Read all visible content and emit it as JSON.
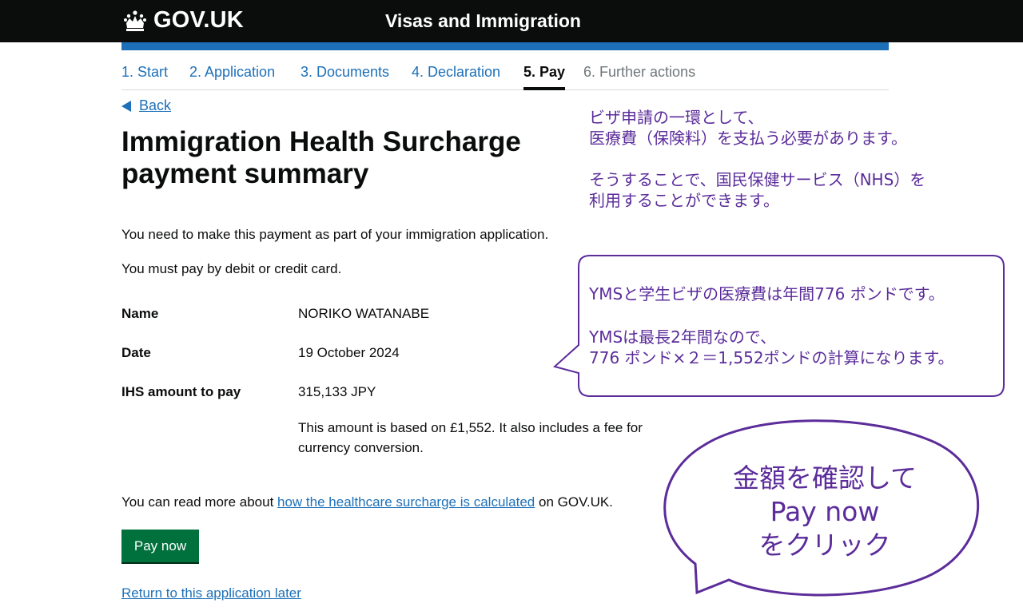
{
  "header": {
    "logo_text": "GOV.UK",
    "service_name": "Visas and Immigration",
    "accent_color": "#1d70b8"
  },
  "steps": [
    {
      "label": "1. Start",
      "state": "complete"
    },
    {
      "label": "2. Application",
      "state": "complete"
    },
    {
      "label": "3. Documents",
      "state": "complete"
    },
    {
      "label": "4. Declaration",
      "state": "complete"
    },
    {
      "label": "5. Pay",
      "state": "current"
    },
    {
      "label": "6. Further actions",
      "state": "disabled"
    }
  ],
  "back_label": "Back",
  "title": "Immigration Health Surcharge payment summary",
  "intro": [
    "You need to make this payment as part of your immigration application.",
    "You must pay by debit or credit card."
  ],
  "summary": [
    {
      "key": "Name",
      "value": "NORIKO WATANABE"
    },
    {
      "key": "Date",
      "value": "19 October 2024"
    },
    {
      "key": "IHS amount to pay",
      "value": "315,133 JPY"
    }
  ],
  "amount_note": "This amount is based on £1,552. It also includes a fee for currency conversion.",
  "read_more": {
    "prefix": "You can read more about ",
    "link": "how the healthcare surcharge is calculated",
    "suffix": " on GOV.UK."
  },
  "pay_button": "Pay now",
  "return_link": "Return to this application later",
  "annotations": {
    "note1": [
      "ビザ申請の一環として、",
      "医療費（保険料）を支払う必要があります。",
      "そうすることで、国民保健サービス（NHS）を",
      "利用することができます。"
    ],
    "note2": [
      "YMSと学生ビザの医療費は年間776 ポンドです。",
      "YMSは最長2年間なので、",
      "776 ポンド×２＝1,552ポンドの計算になります。"
    ],
    "note3": [
      "金額を確認して",
      "Pay now",
      "をクリック"
    ],
    "color": "#5b2c9a"
  }
}
